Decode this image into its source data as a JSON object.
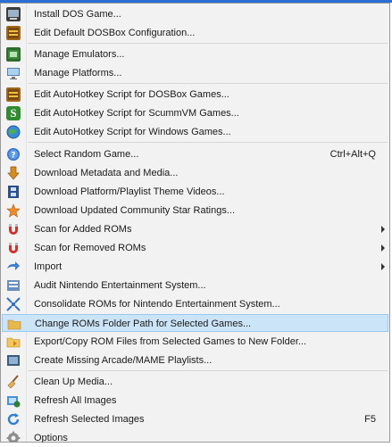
{
  "menu": {
    "items": [
      {
        "label": "Install DOS Game...",
        "icon": "dos-install-icon"
      },
      {
        "label": "Edit Default DOSBox Configuration...",
        "icon": "dosbox-icon"
      },
      {
        "label": "Manage Emulators...",
        "icon": "emulator-icon"
      },
      {
        "label": "Manage Platforms...",
        "icon": "platform-monitor-icon"
      },
      {
        "label": "Edit AutoHotkey Script for DOSBox Games...",
        "icon": "dosbox-icon"
      },
      {
        "label": "Edit AutoHotkey Script for ScummVM Games...",
        "icon": "scummvm-icon"
      },
      {
        "label": "Edit AutoHotkey Script for Windows Games...",
        "icon": "windows-globe-icon"
      },
      {
        "label": "Select Random Game...",
        "icon": "random-question-icon",
        "shortcut": "Ctrl+Alt+Q"
      },
      {
        "label": "Download Metadata and Media...",
        "icon": "download-icon"
      },
      {
        "label": "Download Platform/Playlist Theme Videos...",
        "icon": "film-icon"
      },
      {
        "label": "Download Updated Community Star Ratings...",
        "icon": "star-icon"
      },
      {
        "label": "Scan for Added ROMs",
        "icon": "magnet-icon",
        "submenu": true
      },
      {
        "label": "Scan for Removed ROMs",
        "icon": "magnet-icon",
        "submenu": true
      },
      {
        "label": "Import",
        "icon": "import-arrow-icon",
        "submenu": true
      },
      {
        "label": "Audit Nintendo Entertainment System...",
        "icon": "audit-icon"
      },
      {
        "label": "Consolidate ROMs for Nintendo Entertainment System...",
        "icon": "consolidate-icon"
      },
      {
        "label": "Change ROMs Folder Path for Selected Games...",
        "icon": "folder-icon",
        "highlighted": true
      },
      {
        "label": "Export/Copy ROM Files from Selected Games to New Folder...",
        "icon": "export-folder-icon"
      },
      {
        "label": "Create Missing Arcade/MAME Playlists...",
        "icon": "playlist-icon"
      },
      {
        "label": "Clean Up Media...",
        "icon": "broom-icon"
      },
      {
        "label": "Refresh All Images",
        "icon": "refresh-images-icon"
      },
      {
        "label": "Refresh Selected Images",
        "icon": "refresh-icon",
        "shortcut": "F5"
      },
      {
        "label": "Options",
        "icon": "gear-icon"
      }
    ]
  },
  "colors": {
    "menu_bg": "#f2f2f2",
    "highlight": "#cce4f7",
    "highlight_border": "#99c9ef",
    "separator": "#d7d7d7"
  }
}
